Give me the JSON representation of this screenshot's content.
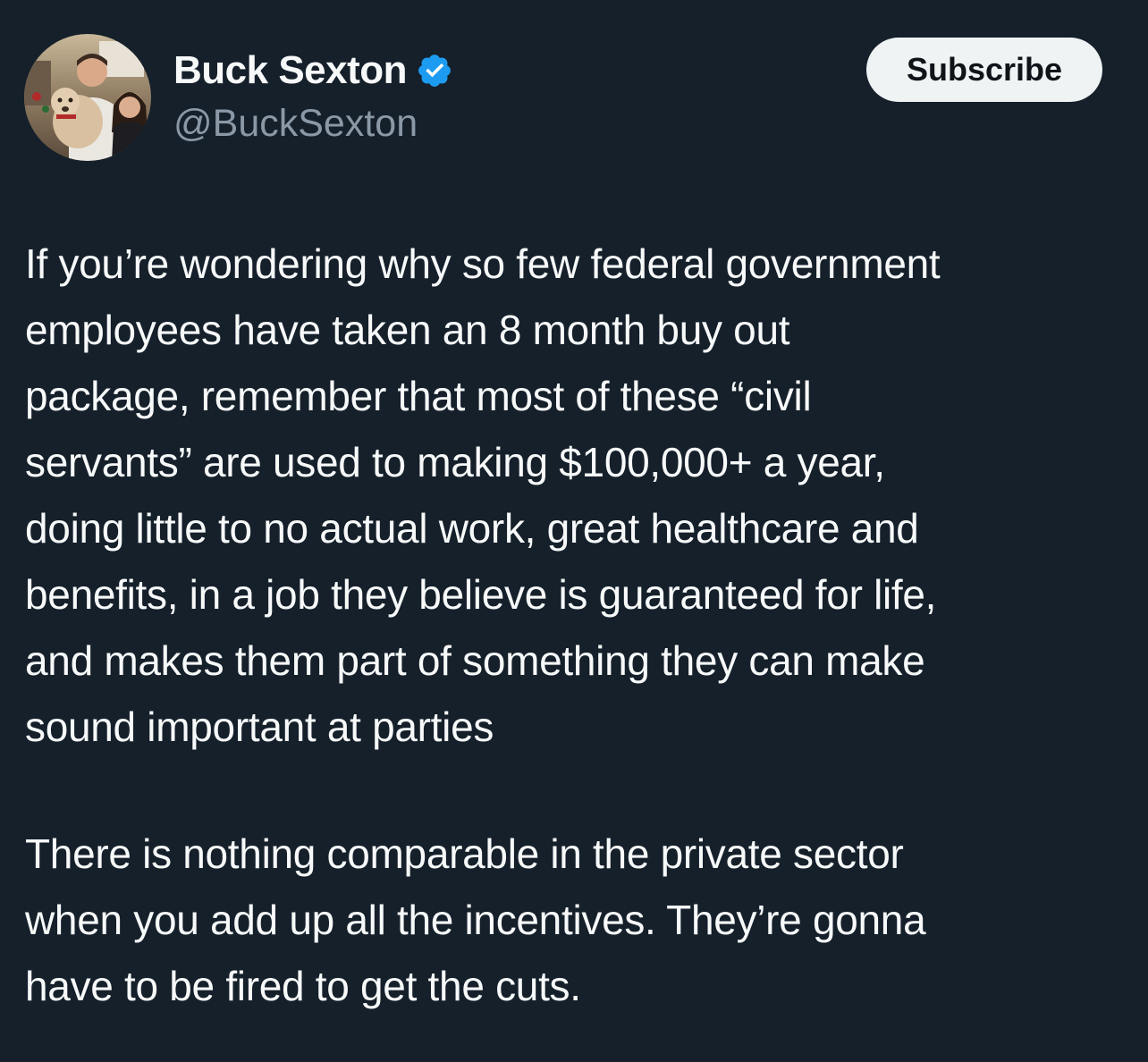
{
  "author": {
    "display_name": "Buck Sexton",
    "handle": "@BuckSexton",
    "verified": true,
    "verified_icon": "verified-badge-icon",
    "avatar": "profile-photo"
  },
  "subscribe_label": "Subscribe",
  "tweet": {
    "paragraph1": [
      "If you’re wondering why so few federal government",
      "employees have taken an 8 month buy out",
      "package, remember that most of these “civil",
      "servants” are used to making $100,000+ a year,",
      "doing little to no actual work, great healthcare and",
      "benefits, in a job they believe is guaranteed  for life,",
      "and makes them part of something they can make",
      "sound important at parties"
    ],
    "paragraph2": [
      "There is nothing comparable in the private sector",
      "when you add up all the incentives. They’re gonna",
      "have to be fired to get the cuts."
    ]
  },
  "colors": {
    "background": "#15202b",
    "text": "#f7f9f9",
    "secondary_text": "#8b98a5",
    "verified_blue": "#1d9bf0",
    "button_bg": "#eff3f4"
  }
}
